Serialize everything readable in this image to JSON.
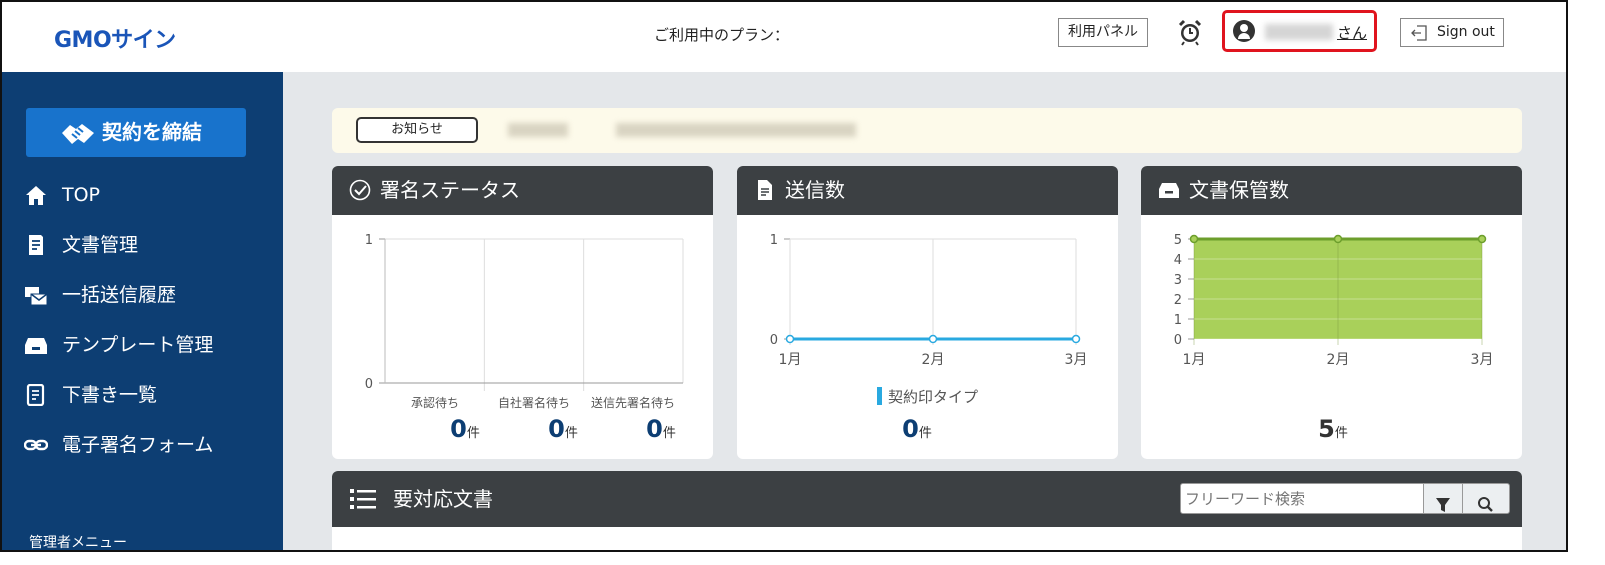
{
  "header": {
    "logo": "GMOサイン",
    "plan_label": "ご利用中のプラン：",
    "panel_button": "利用パネル",
    "user_suffix": "さん",
    "signout_label": "Sign out"
  },
  "sidebar": {
    "contract_button": "契約を締結",
    "items": [
      {
        "label": "TOP",
        "icon": "home-icon"
      },
      {
        "label": "文書管理",
        "icon": "document-icon"
      },
      {
        "label": "一括送信履歴",
        "icon": "batch-send-icon"
      },
      {
        "label": "テンプレート管理",
        "icon": "template-box-icon"
      },
      {
        "label": "下書き一覧",
        "icon": "draft-icon"
      },
      {
        "label": "電子署名フォーム",
        "icon": "link-icon"
      }
    ],
    "admin_menu": "管理者メニュー"
  },
  "notice": {
    "button_label": "お知らせ"
  },
  "cards": {
    "signature_status": {
      "title": "署名ステータス",
      "categories": [
        "承認待ち",
        "自社署名待ち",
        "送信先署名待ち"
      ],
      "counts": [
        "0",
        "0",
        "0"
      ],
      "unit": "件"
    },
    "sent_count": {
      "title": "送信数",
      "legend": "契約印タイプ",
      "count": "0",
      "unit": "件"
    },
    "stored_docs": {
      "title": "文書保管数",
      "count": "5",
      "unit": "件"
    }
  },
  "todo": {
    "title": "要対応文書",
    "search_placeholder": "フリーワード検索"
  },
  "chart_data": [
    {
      "type": "bar",
      "title": "署名ステータス",
      "categories": [
        "承認待ち",
        "自社署名待ち",
        "送信先署名待ち"
      ],
      "values": [
        0,
        0,
        0
      ],
      "ylim": [
        0,
        1
      ],
      "yticks": [
        "0",
        "1"
      ],
      "grid": true
    },
    {
      "type": "line",
      "title": "送信数",
      "categories": [
        "1月",
        "2月",
        "3月"
      ],
      "series": [
        {
          "name": "契約印タイプ",
          "values": [
            0,
            0,
            0
          ],
          "color": "#29a9e0"
        }
      ],
      "ylim": [
        0,
        1
      ],
      "yticks": [
        "0",
        "1"
      ],
      "legend": "bottom",
      "grid": true
    },
    {
      "type": "area",
      "title": "文書保管数",
      "categories": [
        "1月",
        "2月",
        "3月"
      ],
      "series": [
        {
          "values": [
            5,
            5,
            5
          ],
          "color": "#a9d05a",
          "line_color": "#6c9e2c"
        }
      ],
      "ylim": [
        0,
        5
      ],
      "yticks": [
        "0",
        "1",
        "2",
        "3",
        "4",
        "5"
      ],
      "grid": true
    }
  ]
}
